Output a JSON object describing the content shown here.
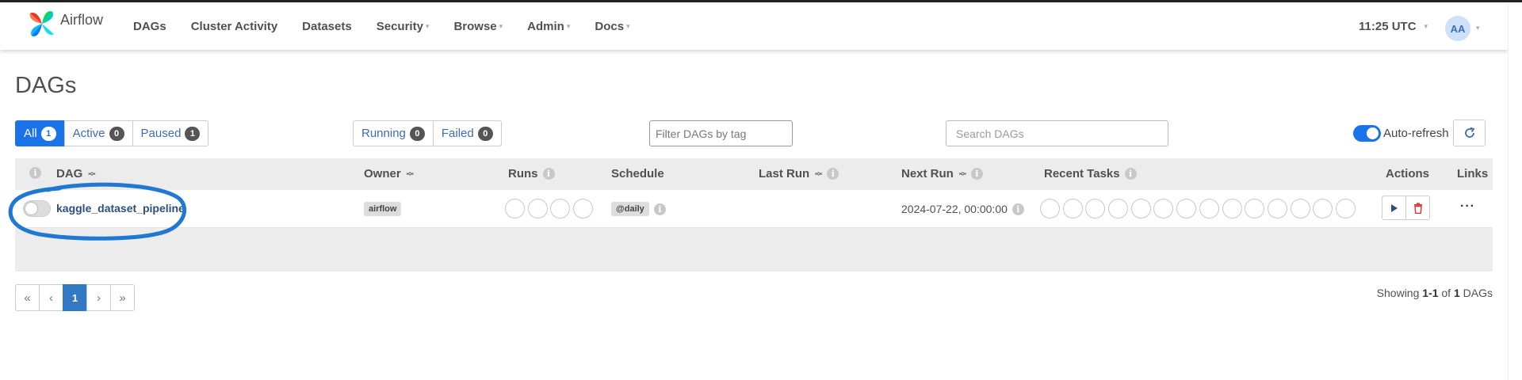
{
  "brand": {
    "name": "Airflow"
  },
  "nav": {
    "items": [
      {
        "label": "DAGs",
        "dropdown": false
      },
      {
        "label": "Cluster Activity",
        "dropdown": false
      },
      {
        "label": "Datasets",
        "dropdown": false
      },
      {
        "label": "Security",
        "dropdown": true
      },
      {
        "label": "Browse",
        "dropdown": true
      },
      {
        "label": "Admin",
        "dropdown": true
      },
      {
        "label": "Docs",
        "dropdown": true
      }
    ],
    "clock": "11:25 UTC",
    "user_initials": "AA"
  },
  "page": {
    "title": "DAGs"
  },
  "filters": {
    "status": [
      {
        "label": "All",
        "count": "1",
        "active": true
      },
      {
        "label": "Active",
        "count": "0",
        "active": false
      },
      {
        "label": "Paused",
        "count": "1",
        "active": false
      }
    ],
    "run_state": [
      {
        "label": "Running",
        "count": "0"
      },
      {
        "label": "Failed",
        "count": "0"
      }
    ],
    "tag_placeholder": "Filter DAGs by tag",
    "search_placeholder": "Search DAGs",
    "auto_refresh_label": "Auto-refresh",
    "auto_refresh_on": true
  },
  "table": {
    "headers": {
      "dag": "DAG",
      "owner": "Owner",
      "runs": "Runs",
      "schedule": "Schedule",
      "last_run": "Last Run",
      "next_run": "Next Run",
      "recent_tasks": "Recent Tasks",
      "actions": "Actions",
      "links": "Links"
    },
    "rows": [
      {
        "dag_id": "kaggle_dataset_pipeline",
        "paused": true,
        "owner": "airflow",
        "schedule": "@daily",
        "last_run": "",
        "next_run": "2024-07-22, 00:00:00",
        "runs_circles": 4,
        "task_circles": 14
      }
    ]
  },
  "pagination": {
    "first": "«",
    "prev": "‹",
    "current": "1",
    "next": "›",
    "last": "»"
  },
  "showing": {
    "prefix": "Showing",
    "range": "1-1",
    "of": "of",
    "total": "1",
    "suffix": "DAGs"
  },
  "colors": {
    "accent": "#1a73e8",
    "annotation": "#1f78d1",
    "link": "#2c4f7c"
  }
}
